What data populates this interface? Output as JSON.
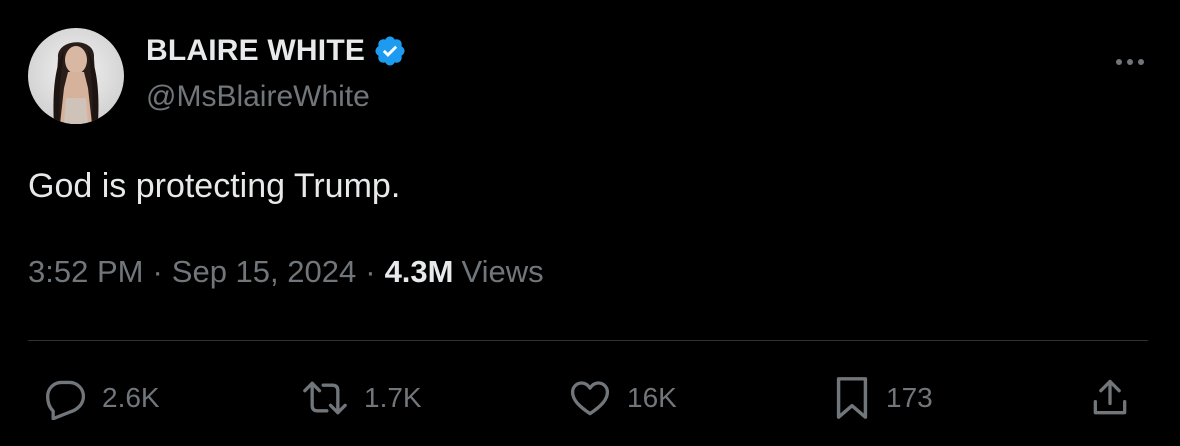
{
  "author": {
    "display_name": "BLAIRE WHITE",
    "handle": "@MsBlaireWhite",
    "verified": true,
    "verified_color": "#1d9bf0"
  },
  "tweet": {
    "text": "God is protecting Trump.",
    "time": "3:52 PM",
    "date": "Sep 15, 2024",
    "separator": "·",
    "views_count": "4.3M",
    "views_label": "Views"
  },
  "actions": {
    "reply_count": "2.6K",
    "retweet_count": "1.7K",
    "like_count": "16K",
    "bookmark_count": "173"
  },
  "icons": {
    "more": "more-dots-icon",
    "reply": "reply-bubble-icon",
    "retweet": "retweet-arrows-icon",
    "like": "heart-icon",
    "bookmark": "bookmark-icon",
    "share": "share-upload-icon"
  },
  "colors": {
    "background": "#000000",
    "primary_text": "#e7e9ea",
    "secondary_text": "#71767b",
    "divider": "#2f3336",
    "accent": "#1d9bf0"
  }
}
